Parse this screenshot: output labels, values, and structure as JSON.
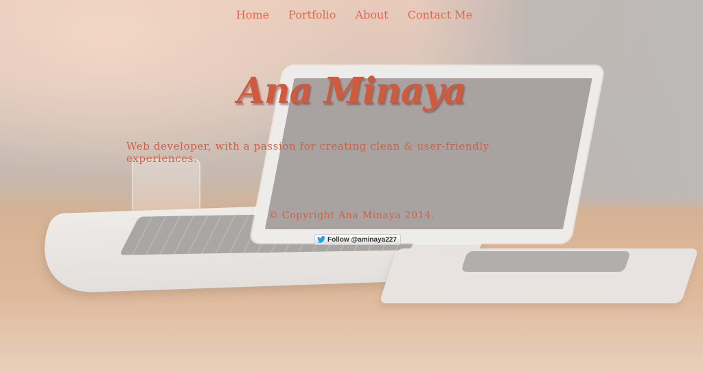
{
  "nav": {
    "items": [
      {
        "label": "Home"
      },
      {
        "label": "Portfolio"
      },
      {
        "label": "About"
      },
      {
        "label": "Contact Me"
      }
    ]
  },
  "hero": {
    "title": "Ana Minaya",
    "tagline": "Web developer, with a passion for creating clean & user-friendly experiences."
  },
  "footer": {
    "copyright": "© Copyright Ana Minaya 2014.",
    "follow_button": {
      "label": "Follow @aminaya227",
      "icon": "twitter-bird-icon"
    }
  },
  "colors": {
    "accent": "#e2684a",
    "title": "#cf5a3d",
    "twitter_blue": "#1da1f2"
  }
}
